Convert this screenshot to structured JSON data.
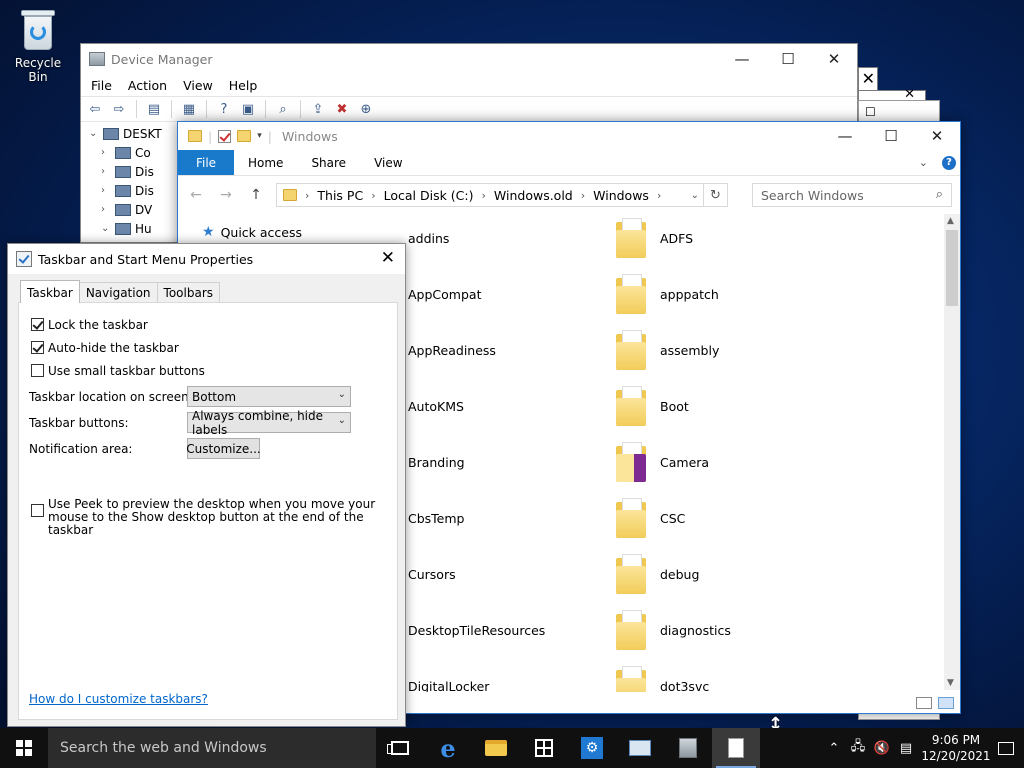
{
  "desktop": {
    "recycle_bin": "Recycle Bin"
  },
  "device_manager": {
    "title": "Device Manager",
    "menu": [
      "File",
      "Action",
      "View",
      "Help"
    ],
    "tree": [
      {
        "label": "DESKT"
      },
      {
        "label": "Co"
      },
      {
        "label": "Dis"
      },
      {
        "label": "Dis"
      },
      {
        "label": "DV"
      },
      {
        "label": "Hu"
      }
    ]
  },
  "explorer": {
    "title": "Windows",
    "ribbon": {
      "file": "File",
      "tabs": [
        "Home",
        "Share",
        "View"
      ]
    },
    "address": [
      "This PC",
      "Local Disk (C:)",
      "Windows.old",
      "Windows"
    ],
    "search_placeholder": "Search Windows",
    "nav": {
      "quick_access": "Quick access"
    },
    "files_col1": [
      "addins",
      "AppCompat",
      "AppReadiness",
      "AutoKMS",
      "Branding",
      "CbsTemp",
      "Cursors",
      "DesktopTileResources",
      "DigitalLocker"
    ],
    "files_col2": [
      "ADFS",
      "apppatch",
      "assembly",
      "Boot",
      "Camera",
      "CSC",
      "debug",
      "diagnostics",
      "dot3svc"
    ]
  },
  "dialog": {
    "title": "Taskbar and Start Menu Properties",
    "tabs": [
      "Taskbar",
      "Navigation",
      "Toolbars"
    ],
    "lock_taskbar": "Lock the taskbar",
    "auto_hide": "Auto-hide the taskbar",
    "small_buttons": "Use small taskbar buttons",
    "location_label": "Taskbar location on screen:",
    "location_value": "Bottom",
    "buttons_label": "Taskbar buttons:",
    "buttons_value": "Always combine, hide labels",
    "notification_label": "Notification area:",
    "customize": "Customize...",
    "peek": "Use Peek to preview the desktop when you move your mouse to the Show desktop button at the end of the taskbar",
    "help_link": "How do I customize taskbars?"
  },
  "taskbar": {
    "search_placeholder": "Search the web and Windows",
    "time": "9:06 PM",
    "date": "12/20/2021"
  }
}
